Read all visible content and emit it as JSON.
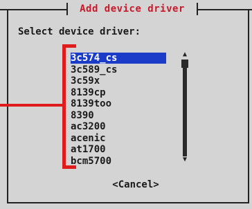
{
  "dialog": {
    "title": "Add device driver",
    "prompt": "Select device driver:",
    "cancel_label": "<Cancel>"
  },
  "drivers": [
    {
      "label": "3c574_cs",
      "selected": true
    },
    {
      "label": "3c589_cs",
      "selected": false
    },
    {
      "label": "3c59x",
      "selected": false
    },
    {
      "label": "8139cp",
      "selected": false
    },
    {
      "label": "8139too",
      "selected": false
    },
    {
      "label": "8390",
      "selected": false
    },
    {
      "label": "ac3200",
      "selected": false
    },
    {
      "label": "acenic",
      "selected": false
    },
    {
      "label": "at1700",
      "selected": false
    },
    {
      "label": "bcm5700",
      "selected": false
    }
  ],
  "scrollbar": {
    "up_arrow": "▲",
    "down_arrow": "▼"
  },
  "colors": {
    "title": "#c8192a",
    "selection": "#1a3cc8",
    "annotation": "#e01b1b"
  }
}
